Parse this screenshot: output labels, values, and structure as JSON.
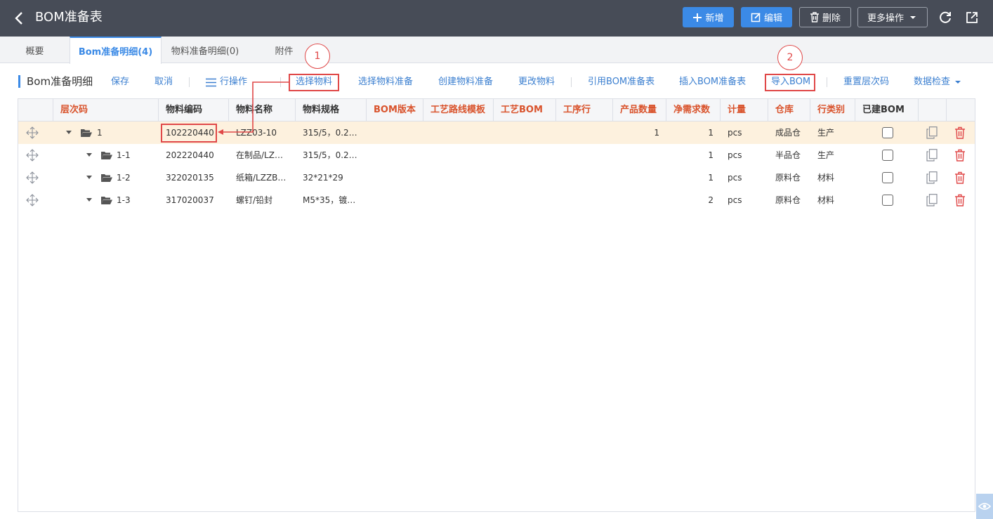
{
  "header": {
    "title": "BOM准备表",
    "buttons": {
      "add": "新增",
      "edit": "编辑",
      "delete": "删除",
      "more": "更多操作"
    }
  },
  "tabs": [
    {
      "label": "概要"
    },
    {
      "label": "Bom准备明细(4)"
    },
    {
      "label": "物料准备明细(0)"
    },
    {
      "label": "附件"
    }
  ],
  "toolbar": {
    "section_title": "Bom准备明细",
    "save": "保存",
    "cancel": "取消",
    "row_ops": "行操作",
    "select_material": "选择物料",
    "select_material_prep": "选择物料准备",
    "create_material_prep": "创建物料准备",
    "change_material": "更改物料",
    "ref_bom_prep": "引用BOM准备表",
    "insert_bom_prep": "插入BOM准备表",
    "import_bom": "导入BOM",
    "reset_level": "重置层次码",
    "data_check": "数据检查"
  },
  "annotations": {
    "one": "1",
    "two": "2"
  },
  "columns": {
    "level": "层次码",
    "code": "物料编码",
    "name": "物料名称",
    "spec": "物料规格",
    "bom_ver": "BOM版本",
    "route": "工艺路线模板",
    "craft_bom": "工艺BOM",
    "op_row": "工序行",
    "prod_qty": "产品数量",
    "net_qty": "净需求数",
    "unit": "计量",
    "warehouse": "仓库",
    "row_type": "行类别",
    "built_bom": "已建BOM"
  },
  "colors": {
    "accent": "#3b8ae6",
    "required_header": "#d9532c",
    "annotation_red": "#e04848",
    "selected_row": "#fdf1de"
  },
  "rows": [
    {
      "level": "1",
      "code": "102220440",
      "name": "LZZ03-10",
      "spec": "315/5，0.2…",
      "prod_qty": "1",
      "net_qty": "1",
      "unit": "pcs",
      "warehouse": "成品仓",
      "row_type": "生产"
    },
    {
      "level": "1-1",
      "code": "202220440",
      "name": "在制品/LZ…",
      "spec": "315/5，0.2…",
      "prod_qty": "",
      "net_qty": "1",
      "unit": "pcs",
      "warehouse": "半品仓",
      "row_type": "生产"
    },
    {
      "level": "1-2",
      "code": "322020135",
      "name": "纸箱/LZZB…",
      "spec": "32*21*29",
      "prod_qty": "",
      "net_qty": "1",
      "unit": "pcs",
      "warehouse": "原料仓",
      "row_type": "材料"
    },
    {
      "level": "1-3",
      "code": "317020037",
      "name": "螺钉/铅封",
      "spec": "M5*35，镀…",
      "prod_qty": "",
      "net_qty": "2",
      "unit": "pcs",
      "warehouse": "原料仓",
      "row_type": "材料"
    }
  ]
}
